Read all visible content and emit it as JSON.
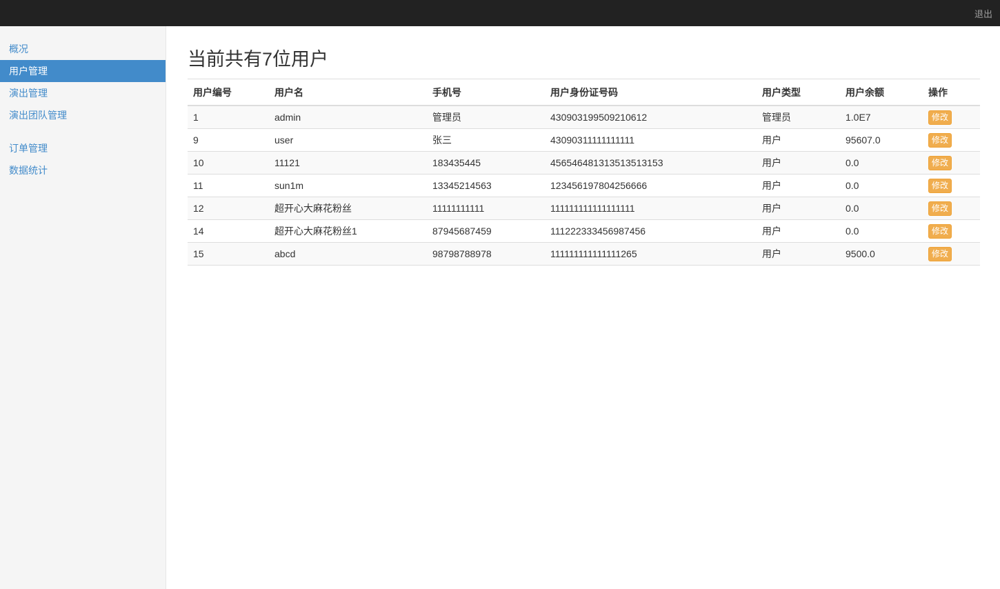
{
  "topbar": {
    "logout_label": "退出"
  },
  "sidebar": {
    "groups": [
      {
        "items": [
          {
            "label": "概况",
            "active": false
          },
          {
            "label": "用户管理",
            "active": true
          },
          {
            "label": "演出管理",
            "active": false
          },
          {
            "label": "演出团队管理",
            "active": false
          }
        ]
      },
      {
        "items": [
          {
            "label": "订单管理",
            "active": false
          },
          {
            "label": "数据统计",
            "active": false
          }
        ]
      }
    ]
  },
  "main": {
    "title": "当前共有7位用户",
    "table": {
      "columns": [
        "用户编号",
        "用户名",
        "手机号",
        "用户身份证号码",
        "用户类型",
        "用户余额",
        "操作"
      ],
      "action_label": "修改",
      "rows": [
        {
          "id": "1",
          "username": "admin",
          "phone": "管理员",
          "id_card": "430903199509210612",
          "user_type": "管理员",
          "balance": "1.0E7"
        },
        {
          "id": "9",
          "username": "user",
          "phone": "张三",
          "id_card": "43090311111111111",
          "user_type": "用户",
          "balance": "95607.0"
        },
        {
          "id": "10",
          "username": "11121",
          "phone": "183435445",
          "id_card": "456546481313513513153",
          "user_type": "用户",
          "balance": "0.0"
        },
        {
          "id": "11",
          "username": "sun1m",
          "phone": "13345214563",
          "id_card": "123456197804256666",
          "user_type": "用户",
          "balance": "0.0"
        },
        {
          "id": "12",
          "username": "超开心大麻花粉丝",
          "phone": "11111111111",
          "id_card": "111111111111111111",
          "user_type": "用户",
          "balance": "0.0"
        },
        {
          "id": "14",
          "username": "超开心大麻花粉丝1",
          "phone": "87945687459",
          "id_card": "111222333456987456",
          "user_type": "用户",
          "balance": "0.0"
        },
        {
          "id": "15",
          "username": "abcd",
          "phone": "98798788978",
          "id_card": "111111111111111265",
          "user_type": "用户",
          "balance": "9500.0"
        }
      ]
    }
  },
  "colors": {
    "navbar_bg": "#222222",
    "navbar_link": "#9d9d9d",
    "sidebar_bg": "#f5f5f5",
    "accent_blue": "#428bca",
    "active_item_text": "#ffffff",
    "table_border": "#dddddd",
    "stripe_bg": "#f9f9f9",
    "warning_button_bg": "#f0ad4e",
    "warning_button_border": "#eea236",
    "text": "#333333"
  }
}
